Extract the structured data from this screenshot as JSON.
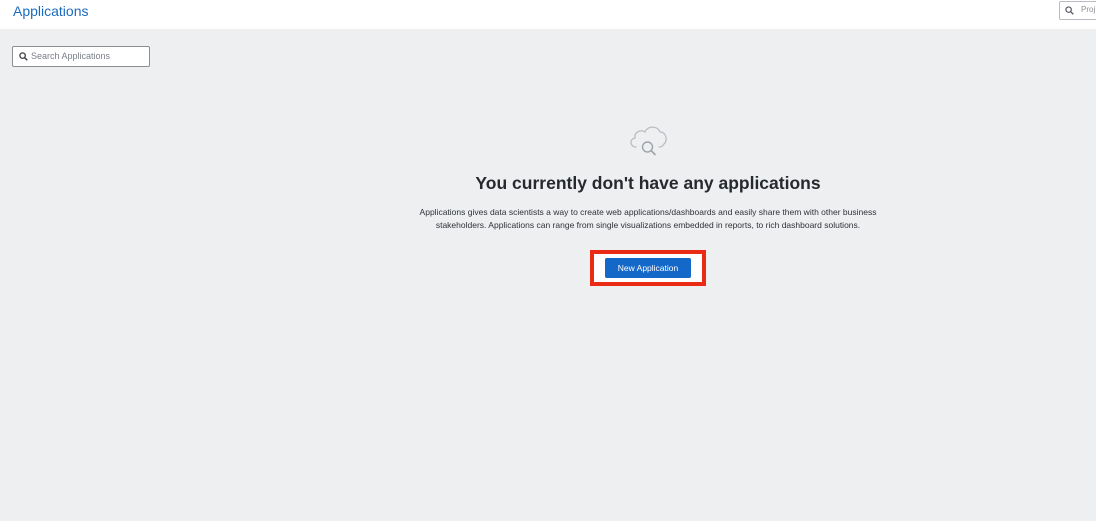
{
  "header": {
    "title": "Applications",
    "project_search_placeholder": "Proj"
  },
  "search": {
    "placeholder": "Search Applications"
  },
  "empty_state": {
    "icon": "cloud-search-icon",
    "title": "You currently don't have any applications",
    "description": "Applications gives data scientists a way to create web applications/dashboards and easily share them with other business stakeholders. Applications can range from single visualizations embedded in reports, to rich dashboard solutions.",
    "button_label": "New Application"
  },
  "colors": {
    "background": "#eeeff1",
    "accent": "#1368c8",
    "title_link": "#1a6bbf",
    "highlight_border": "#ea2b14"
  }
}
